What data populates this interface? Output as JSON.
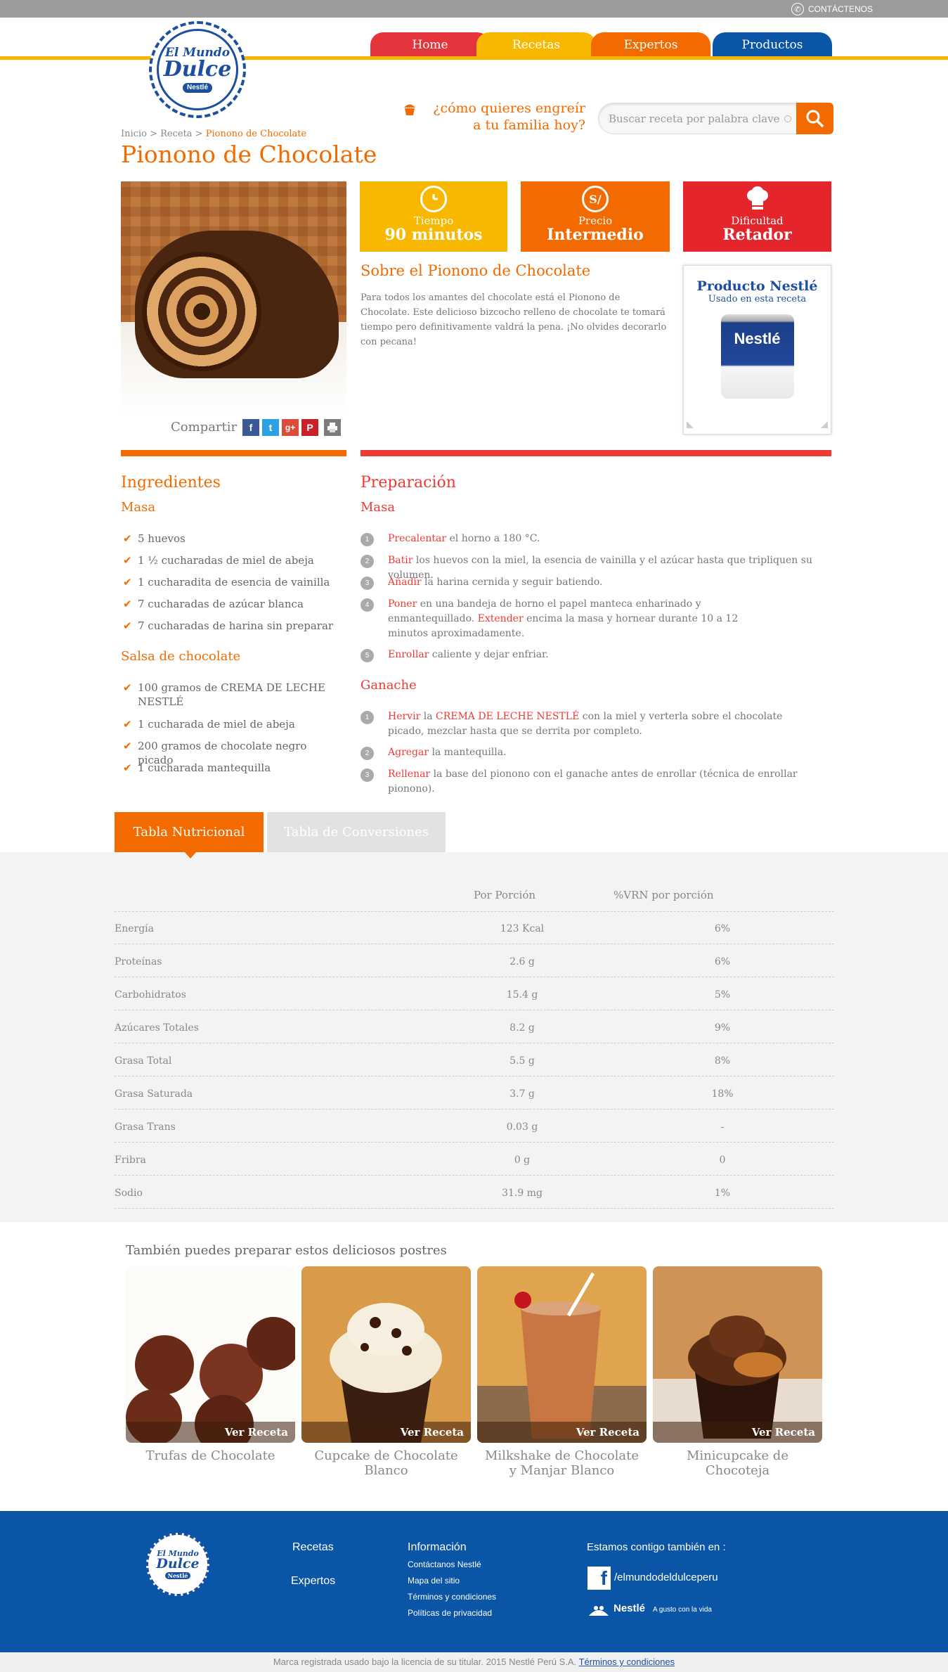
{
  "header": {
    "contact_label": "CONTÁCTENOS",
    "logo": {
      "line1": "El Mundo",
      "line2": "Dulce",
      "badge": "Nestlé"
    },
    "nav": [
      {
        "label": "Home",
        "color": "#e4353c"
      },
      {
        "label": "Recetas",
        "color": "#f9b800"
      },
      {
        "label": "Expertos",
        "color": "#f36b00"
      },
      {
        "label": "Productos",
        "color": "#0a55a6"
      }
    ],
    "question_line1": "¿cómo quieres engreír",
    "question_line2": "a tu familia hoy?",
    "search_placeholder": "Buscar receta por palabra clave"
  },
  "breadcrumb": {
    "home": "Inicio",
    "sep1": " > ",
    "section": "Receta",
    "sep2": " > ",
    "current": "Pionono de Chocolate"
  },
  "recipe": {
    "title": "Pionono de Chocolate",
    "share_label": "Compartir",
    "share_icons": [
      "f",
      "t",
      "g+",
      "p",
      "print"
    ],
    "info": [
      {
        "label": "Tiempo",
        "value": "90 minutos",
        "icon": "clock-icon",
        "color": "#f9b800"
      },
      {
        "label": "Precio",
        "value": "Intermedio",
        "icon": "S/",
        "color": "#f36b00"
      },
      {
        "label": "Dificultad",
        "value": "Retador",
        "icon": "chef-hat-icon",
        "color": "#e4262c"
      }
    ],
    "about_title": "Sobre el Pionono de Chocolate",
    "about_text": "Para todos los amantes del chocolate está el Pionono de Chocolate. Este delicioso bizcocho relleno de chocolate te tomará tiempo pero definitivamente valdrá la pena. ¡No olvides decorarlo con pecana!",
    "product": {
      "title": "Producto Nestlé",
      "subtitle": "Usado en esta receta",
      "can_label": "Nestlé"
    }
  },
  "ingredients": {
    "heading": "Ingredientes",
    "groups": [
      {
        "title": "Masa",
        "items": [
          "5 huevos",
          "1 ½ cucharadas de miel de abeja",
          "1 cucharadita de esencia de vainilla",
          "7 cucharadas de azúcar blanca",
          "7 cucharadas de harina sin preparar"
        ]
      },
      {
        "title": "Salsa de chocolate",
        "items": [
          "100 gramos de CREMA DE LECHE NESTLÉ",
          "1 cucharada de miel de abeja",
          "200 gramos de chocolate negro picado",
          "1 cucharada mantequilla"
        ]
      }
    ]
  },
  "preparation": {
    "heading": "Preparación",
    "groups": [
      {
        "title": "Masa",
        "steps": [
          {
            "n": "1",
            "verb": "Precalentar",
            "text": " el horno a 180 °C."
          },
          {
            "n": "2",
            "verb": "Batir",
            "text": " los huevos con la miel, la esencia de vainilla y el azúcar hasta que tripliquen su volumen."
          },
          {
            "n": "3",
            "verb": "Añadir",
            "text": " la harina cernida y seguir batiendo."
          },
          {
            "n": "4",
            "verb": "Poner",
            "text": " en una bandeja de horno el papel manteca enharinado y enmantequillado. ",
            "verb2": "Extender",
            "text2": " encima la masa y hornear durante 10 a 12 minutos aproximadamente."
          },
          {
            "n": "5",
            "verb": "Enrollar",
            "text": " caliente y dejar enfriar."
          }
        ]
      },
      {
        "title": "Ganache",
        "steps": [
          {
            "n": "1",
            "verb": "Hervir",
            "text": " la ",
            "verb2": "CREMA DE LECHE NESTLÉ",
            "text2": " con la miel y verterla sobre el chocolate picado, mezclar hasta que se derrita por completo."
          },
          {
            "n": "2",
            "verb": "Agregar",
            "text": " la mantequilla."
          },
          {
            "n": "3",
            "verb": "Rellenar",
            "text": " la base del pionono con el ganache antes de enrollar (técnica de enrollar pionono)."
          }
        ]
      }
    ]
  },
  "nutrition": {
    "tabs": [
      "Tabla Nutricional",
      "Tabla de Conversiones"
    ],
    "col_portion": "Por Porción",
    "col_vrn": "%VRN por porción",
    "rows": [
      {
        "name": "Energía",
        "portion": "123 Kcal",
        "vrn": "6%"
      },
      {
        "name": "Proteínas",
        "portion": "2.6 g",
        "vrn": "6%"
      },
      {
        "name": "Carbohidratos",
        "portion": "15.4 g",
        "vrn": "5%"
      },
      {
        "name": "Azúcares Totales",
        "portion": "8.2 g",
        "vrn": "9%"
      },
      {
        "name": "Grasa Total",
        "portion": "5.5 g",
        "vrn": "8%"
      },
      {
        "name": "Grasa Saturada",
        "portion": "3.7 g",
        "vrn": "18%"
      },
      {
        "name": "Grasa Trans",
        "portion": "0.03 g",
        "vrn": "-"
      },
      {
        "name": "Fribra",
        "portion": "0 g",
        "vrn": "0"
      },
      {
        "name": "Sodio",
        "portion": "31.9 mg",
        "vrn": "1%"
      }
    ]
  },
  "related": {
    "heading": "También puedes preparar estos deliciosos postres",
    "cta": "Ver Receta",
    "items": [
      {
        "title1": "Trufas de Chocolate",
        "title2": ""
      },
      {
        "title1": "Cupcake de Chocolate",
        "title2": "Blanco"
      },
      {
        "title1": "Milkshake de Chocolate",
        "title2": "y Manjar Blanco"
      },
      {
        "title1": "Minicupcake de",
        "title2": "Chocoteja"
      }
    ]
  },
  "footer": {
    "links_col1": [
      "Recetas",
      "Expertos"
    ],
    "info_title": "Información",
    "info_links": [
      "Contáctanos Nestlé",
      "Mapa del sitio",
      "Términos y condiciones",
      "Políticas de privacidad"
    ],
    "social_title": "Estamos contigo también en :",
    "facebook": "/elmundodeldulceperu",
    "nestle_logo": "Nestlé",
    "nestle_tagline": "A gusto con la vida",
    "copyright": "Marca registrada usado bajo la licencia de su titular. 2015 Nestlé Perú S.A.",
    "terms_link": "Términos y condiciones"
  }
}
